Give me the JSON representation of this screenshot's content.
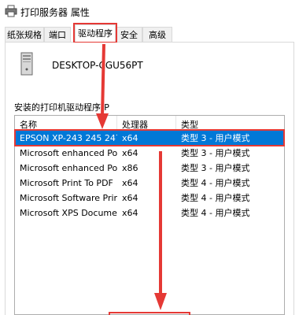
{
  "window": {
    "title": "打印服务器 属性"
  },
  "tabs": [
    {
      "label": "纸张规格"
    },
    {
      "label": "端口"
    },
    {
      "label": "驱动程序"
    },
    {
      "label": "安全"
    },
    {
      "label": "高级"
    }
  ],
  "computer": {
    "name": "DESKTOP-CGU56PT"
  },
  "drivers": {
    "label": "安装的打印机驱动程序(P",
    "columns": [
      "名称",
      "处理器",
      "类型"
    ],
    "rows": [
      {
        "name": "EPSON XP-243 245 247...",
        "processor": "x64",
        "type": "类型 3 - 用户模式"
      },
      {
        "name": "Microsoft enhanced Poi...",
        "processor": "x64",
        "type": "类型 3 - 用户模式"
      },
      {
        "name": "Microsoft enhanced Poi...",
        "processor": "x86",
        "type": "类型 3 - 用户模式"
      },
      {
        "name": "Microsoft Print To PDF",
        "processor": "x64",
        "type": "类型 4 - 用户模式"
      },
      {
        "name": "Microsoft Software Prin...",
        "processor": "x64",
        "type": "类型 4 - 用户模式"
      },
      {
        "name": "Microsoft XPS Docume...",
        "processor": "x64",
        "type": "类型 4 - 用户模式"
      }
    ],
    "selected_row": 0
  },
  "colors": {
    "selection": "#0078d7",
    "annotation": "#e53935"
  }
}
